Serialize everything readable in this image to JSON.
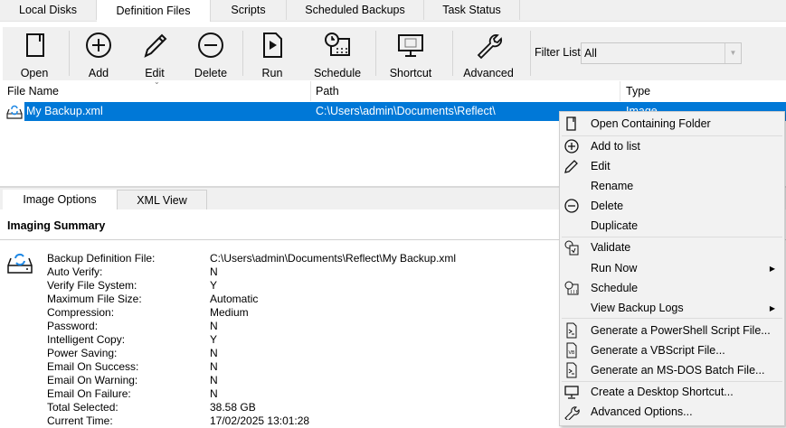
{
  "tabs": [
    {
      "label": "Local Disks"
    },
    {
      "label": "Definition Files",
      "active": true
    },
    {
      "label": "Scripts"
    },
    {
      "label": "Scheduled Backups"
    },
    {
      "label": "Task Status"
    }
  ],
  "toolbar": {
    "open": "Open",
    "add": "Add",
    "edit": "Edit",
    "delete": "Delete",
    "run": "Run",
    "schedule": "Schedule",
    "shortcut": "Shortcut",
    "advanced": "Advanced",
    "filter_label": "Filter List",
    "filter_value": "All"
  },
  "list": {
    "columns": [
      "File Name",
      "Path",
      "Type"
    ],
    "rows": [
      {
        "name": "My Backup.xml",
        "path": "C:\\Users\\admin\\Documents\\Reflect\\",
        "type": "Image"
      }
    ]
  },
  "bottom_tabs": [
    {
      "label": "Image Options",
      "active": true
    },
    {
      "label": "XML View"
    }
  ],
  "summary": {
    "title": "Imaging Summary",
    "rows": [
      {
        "label": "Backup Definition File:",
        "value": "C:\\Users\\admin\\Documents\\Reflect\\My Backup.xml"
      },
      {
        "label": "Auto Verify:",
        "value": "N"
      },
      {
        "label": "Verify File System:",
        "value": "Y"
      },
      {
        "label": "Maximum File Size:",
        "value": "Automatic"
      },
      {
        "label": "Compression:",
        "value": "Medium"
      },
      {
        "label": "Password:",
        "value": "N"
      },
      {
        "label": "Intelligent Copy:",
        "value": "Y"
      },
      {
        "label": "Power Saving:",
        "value": "N"
      },
      {
        "label": "Email On Success:",
        "value": "N"
      },
      {
        "label": "Email On Warning:",
        "value": "N"
      },
      {
        "label": "Email On Failure:",
        "value": "N"
      },
      {
        "label": "Total Selected:",
        "value": "38.58 GB"
      },
      {
        "label": "Current Time:",
        "value": "17/02/2025 13:01:28"
      }
    ]
  },
  "context_menu": {
    "items": [
      {
        "label": "Open Containing Folder",
        "icon": "folder-icon"
      },
      {
        "label": "Add to list",
        "icon": "add-icon"
      },
      {
        "label": "Edit",
        "icon": "pencil-icon"
      },
      {
        "label": "Rename"
      },
      {
        "label": "Delete",
        "icon": "minus-circle-icon"
      },
      {
        "label": "Duplicate"
      },
      {
        "label": "Validate",
        "icon": "validate-icon"
      },
      {
        "label": "Run Now",
        "submenu": true
      },
      {
        "label": "Schedule",
        "icon": "calendar-clock-icon"
      },
      {
        "label": "View Backup Logs",
        "submenu": true
      },
      {
        "label": "Generate a PowerShell Script File...",
        "icon": "powershell-icon"
      },
      {
        "label": "Generate a VBScript File...",
        "icon": "vbscript-icon"
      },
      {
        "label": "Generate an MS-DOS Batch File...",
        "icon": "batch-icon"
      },
      {
        "label": "Create a Desktop Shortcut...",
        "icon": "monitor-icon"
      },
      {
        "label": "Advanced Options...",
        "icon": "wrench-icon"
      }
    ]
  },
  "colors": {
    "selection": "#0078d7",
    "accent_icon": "#1e88e5"
  }
}
